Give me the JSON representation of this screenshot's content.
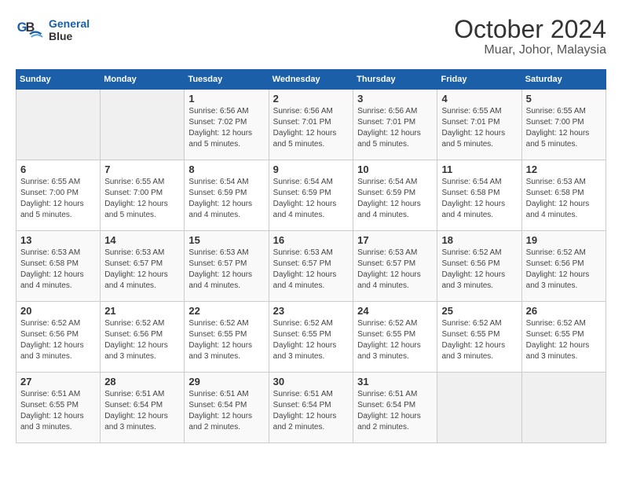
{
  "header": {
    "logo_line1": "General",
    "logo_line2": "Blue",
    "title": "October 2024",
    "subtitle": "Muar, Johor, Malaysia"
  },
  "weekdays": [
    "Sunday",
    "Monday",
    "Tuesday",
    "Wednesday",
    "Thursday",
    "Friday",
    "Saturday"
  ],
  "weeks": [
    [
      {
        "day": "",
        "detail": ""
      },
      {
        "day": "",
        "detail": ""
      },
      {
        "day": "1",
        "detail": "Sunrise: 6:56 AM\nSunset: 7:02 PM\nDaylight: 12 hours\nand 5 minutes."
      },
      {
        "day": "2",
        "detail": "Sunrise: 6:56 AM\nSunset: 7:01 PM\nDaylight: 12 hours\nand 5 minutes."
      },
      {
        "day": "3",
        "detail": "Sunrise: 6:56 AM\nSunset: 7:01 PM\nDaylight: 12 hours\nand 5 minutes."
      },
      {
        "day": "4",
        "detail": "Sunrise: 6:55 AM\nSunset: 7:01 PM\nDaylight: 12 hours\nand 5 minutes."
      },
      {
        "day": "5",
        "detail": "Sunrise: 6:55 AM\nSunset: 7:00 PM\nDaylight: 12 hours\nand 5 minutes."
      }
    ],
    [
      {
        "day": "6",
        "detail": "Sunrise: 6:55 AM\nSunset: 7:00 PM\nDaylight: 12 hours\nand 5 minutes."
      },
      {
        "day": "7",
        "detail": "Sunrise: 6:55 AM\nSunset: 7:00 PM\nDaylight: 12 hours\nand 5 minutes."
      },
      {
        "day": "8",
        "detail": "Sunrise: 6:54 AM\nSunset: 6:59 PM\nDaylight: 12 hours\nand 4 minutes."
      },
      {
        "day": "9",
        "detail": "Sunrise: 6:54 AM\nSunset: 6:59 PM\nDaylight: 12 hours\nand 4 minutes."
      },
      {
        "day": "10",
        "detail": "Sunrise: 6:54 AM\nSunset: 6:59 PM\nDaylight: 12 hours\nand 4 minutes."
      },
      {
        "day": "11",
        "detail": "Sunrise: 6:54 AM\nSunset: 6:58 PM\nDaylight: 12 hours\nand 4 minutes."
      },
      {
        "day": "12",
        "detail": "Sunrise: 6:53 AM\nSunset: 6:58 PM\nDaylight: 12 hours\nand 4 minutes."
      }
    ],
    [
      {
        "day": "13",
        "detail": "Sunrise: 6:53 AM\nSunset: 6:58 PM\nDaylight: 12 hours\nand 4 minutes."
      },
      {
        "day": "14",
        "detail": "Sunrise: 6:53 AM\nSunset: 6:57 PM\nDaylight: 12 hours\nand 4 minutes."
      },
      {
        "day": "15",
        "detail": "Sunrise: 6:53 AM\nSunset: 6:57 PM\nDaylight: 12 hours\nand 4 minutes."
      },
      {
        "day": "16",
        "detail": "Sunrise: 6:53 AM\nSunset: 6:57 PM\nDaylight: 12 hours\nand 4 minutes."
      },
      {
        "day": "17",
        "detail": "Sunrise: 6:53 AM\nSunset: 6:57 PM\nDaylight: 12 hours\nand 4 minutes."
      },
      {
        "day": "18",
        "detail": "Sunrise: 6:52 AM\nSunset: 6:56 PM\nDaylight: 12 hours\nand 3 minutes."
      },
      {
        "day": "19",
        "detail": "Sunrise: 6:52 AM\nSunset: 6:56 PM\nDaylight: 12 hours\nand 3 minutes."
      }
    ],
    [
      {
        "day": "20",
        "detail": "Sunrise: 6:52 AM\nSunset: 6:56 PM\nDaylight: 12 hours\nand 3 minutes."
      },
      {
        "day": "21",
        "detail": "Sunrise: 6:52 AM\nSunset: 6:56 PM\nDaylight: 12 hours\nand 3 minutes."
      },
      {
        "day": "22",
        "detail": "Sunrise: 6:52 AM\nSunset: 6:55 PM\nDaylight: 12 hours\nand 3 minutes."
      },
      {
        "day": "23",
        "detail": "Sunrise: 6:52 AM\nSunset: 6:55 PM\nDaylight: 12 hours\nand 3 minutes."
      },
      {
        "day": "24",
        "detail": "Sunrise: 6:52 AM\nSunset: 6:55 PM\nDaylight: 12 hours\nand 3 minutes."
      },
      {
        "day": "25",
        "detail": "Sunrise: 6:52 AM\nSunset: 6:55 PM\nDaylight: 12 hours\nand 3 minutes."
      },
      {
        "day": "26",
        "detail": "Sunrise: 6:52 AM\nSunset: 6:55 PM\nDaylight: 12 hours\nand 3 minutes."
      }
    ],
    [
      {
        "day": "27",
        "detail": "Sunrise: 6:51 AM\nSunset: 6:55 PM\nDaylight: 12 hours\nand 3 minutes."
      },
      {
        "day": "28",
        "detail": "Sunrise: 6:51 AM\nSunset: 6:54 PM\nDaylight: 12 hours\nand 3 minutes."
      },
      {
        "day": "29",
        "detail": "Sunrise: 6:51 AM\nSunset: 6:54 PM\nDaylight: 12 hours\nand 2 minutes."
      },
      {
        "day": "30",
        "detail": "Sunrise: 6:51 AM\nSunset: 6:54 PM\nDaylight: 12 hours\nand 2 minutes."
      },
      {
        "day": "31",
        "detail": "Sunrise: 6:51 AM\nSunset: 6:54 PM\nDaylight: 12 hours\nand 2 minutes."
      },
      {
        "day": "",
        "detail": ""
      },
      {
        "day": "",
        "detail": ""
      }
    ]
  ]
}
